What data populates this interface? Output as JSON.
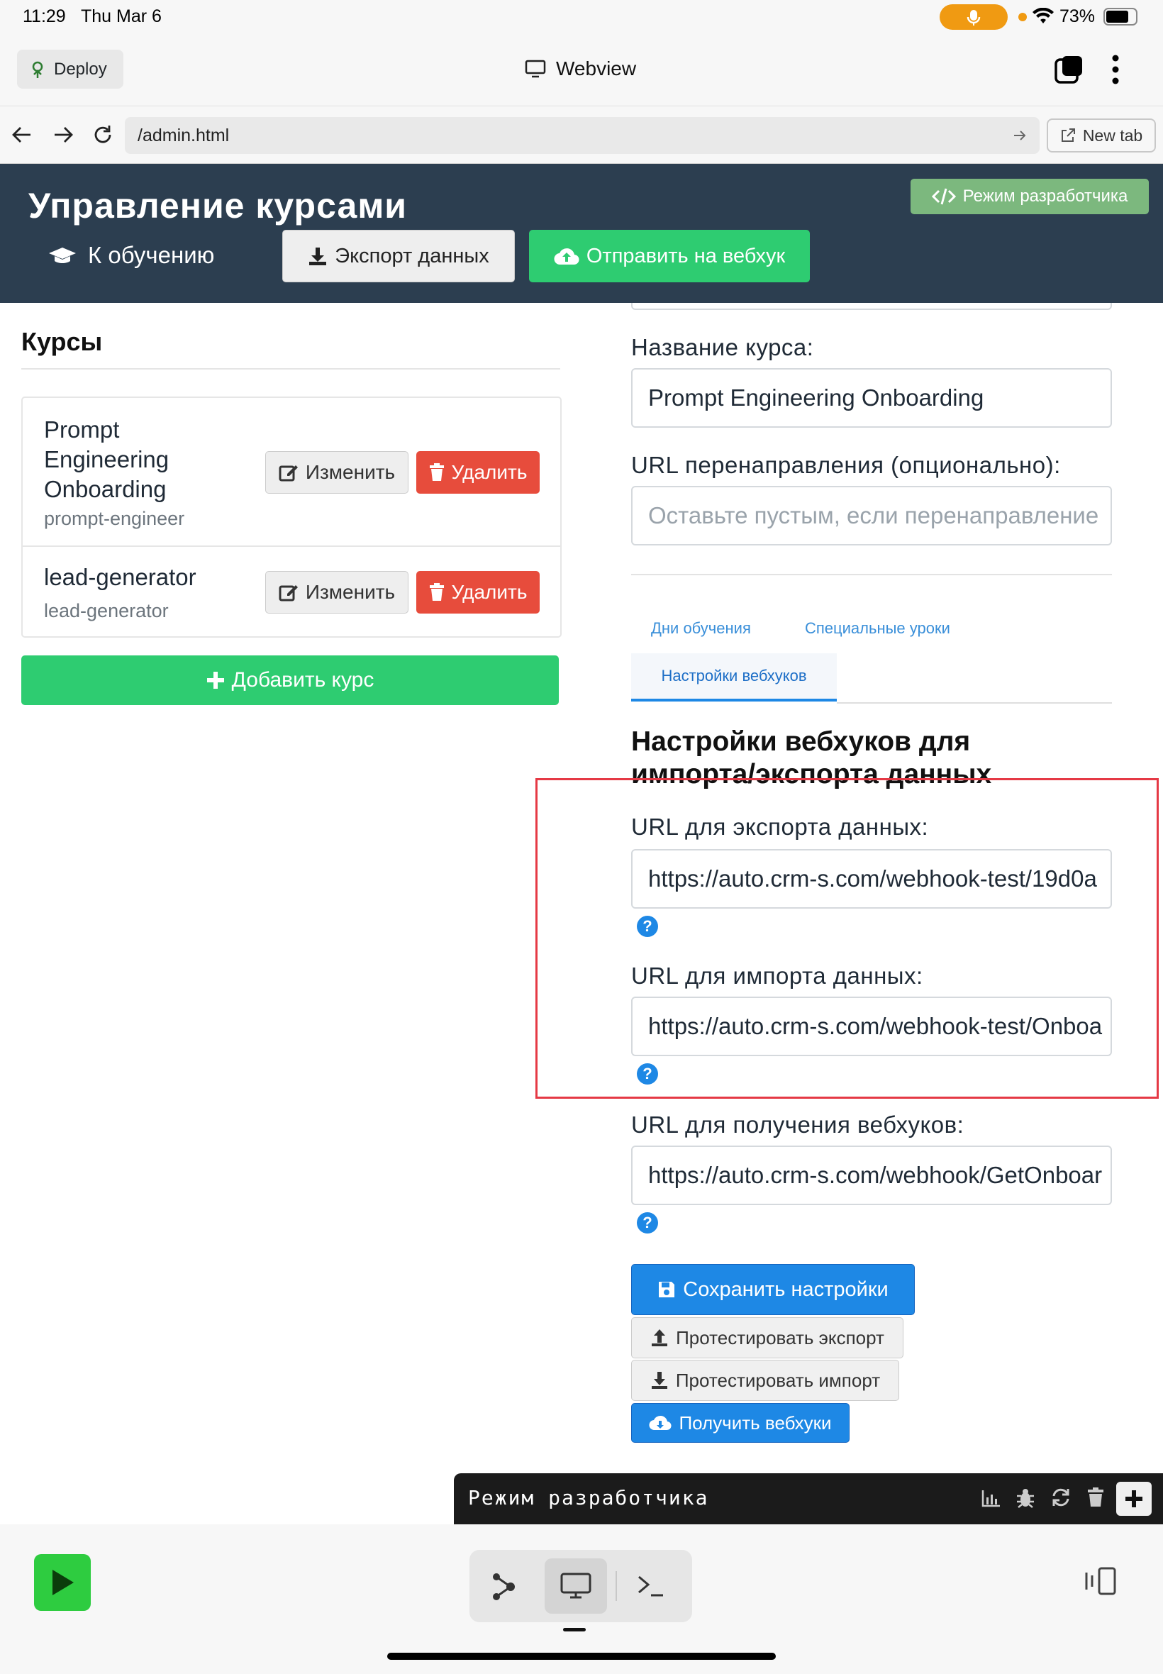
{
  "status": {
    "time": "11:29",
    "date": "Thu Mar 6",
    "battery": "73%"
  },
  "topbar": {
    "deploy_label": "Deploy",
    "title": "Webview"
  },
  "urlbar": {
    "url": "/admin.html",
    "newtab_label": "New tab"
  },
  "header": {
    "title": "Управление курсами",
    "back_label": "К обучению",
    "export_label": "Экспорт данных",
    "send_label": "Отправить на вебхук",
    "devmode_label": "Режим разработчика"
  },
  "courses": {
    "heading": "Курсы",
    "items": [
      {
        "title_line1": "Prompt",
        "title_line2": "Engineering",
        "title_line3": "Onboarding",
        "slug": "prompt-engineer"
      },
      {
        "title_line1": "lead-generator",
        "slug": "lead-generator"
      }
    ],
    "edit_label": "Изменить",
    "delete_label": "Удалить",
    "add_label": "Добавить курс"
  },
  "form": {
    "name_label": "Название курса:",
    "name_value": "Prompt Engineering Onboarding",
    "redirect_label": "URL перенаправления (опционально):",
    "redirect_placeholder": "Оставьте пустым, если перенаправление",
    "tabs": [
      {
        "label": "Дни обучения"
      },
      {
        "label": "Специальные уроки"
      },
      {
        "label": "Настройки вебхуков"
      }
    ],
    "section_title_line1": "Настройки вебхуков для",
    "section_title_line2": "импорта/экспорта данных",
    "export_url_label": "URL для экспорта данных:",
    "export_url_value": "https://auto.crm-s.com/webhook-test/19d0a",
    "import_url_label": "URL для импорта данных:",
    "import_url_value": "https://auto.crm-s.com/webhook-test/Onboa",
    "receive_url_label": "URL для получения вебхуков:",
    "receive_url_value": "https://auto.crm-s.com/webhook/GetOnboar",
    "help_glyph": "?",
    "save_label": "Сохранить настройки",
    "test_export_label": "Протестировать экспорт",
    "test_import_label": "Протестировать импорт",
    "get_webhooks_label": "Получить вебхуки"
  },
  "devpanel": {
    "title": "Режим разработчика"
  },
  "colors": {
    "header_bg": "#2c3e50",
    "green": "#2ecc71",
    "red": "#e74c3c",
    "blue": "#1e88e5",
    "highlight": "#e53945"
  }
}
